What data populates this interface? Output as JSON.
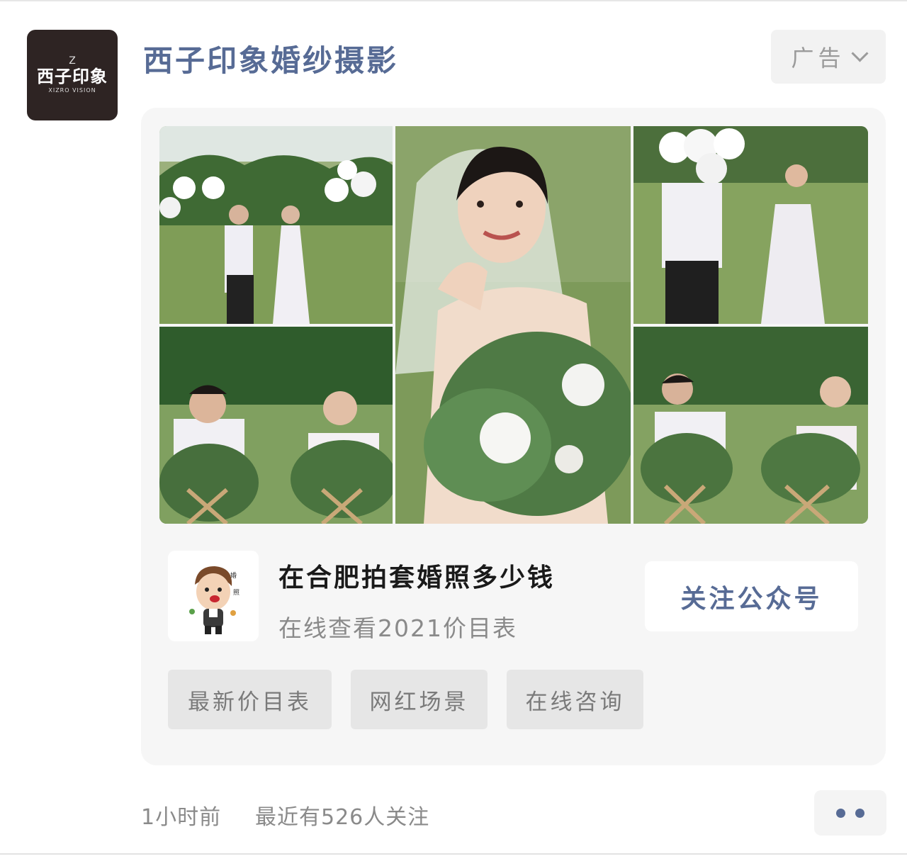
{
  "account": {
    "name": "西子印象婚纱摄影",
    "avatar_mark": "Z",
    "avatar_logo_cn": "西子印象",
    "avatar_logo_en": "XIZRO VISION"
  },
  "ad_label": "广告",
  "ad": {
    "title": "在合肥拍套婚照多少钱",
    "subtitle": "在线查看2021价目表",
    "follow_label": "关注公众号",
    "tags": [
      "最新价目表",
      "网红场景",
      "在线咨询"
    ]
  },
  "footer": {
    "time": "1小时前",
    "followers": "最近有526人关注"
  },
  "colors": {
    "link_blue": "#576b95",
    "card_bg": "#f6f6f6",
    "tag_bg": "#e6e6e6"
  },
  "icons": [
    "chevron-down-icon",
    "more-dots-icon"
  ]
}
